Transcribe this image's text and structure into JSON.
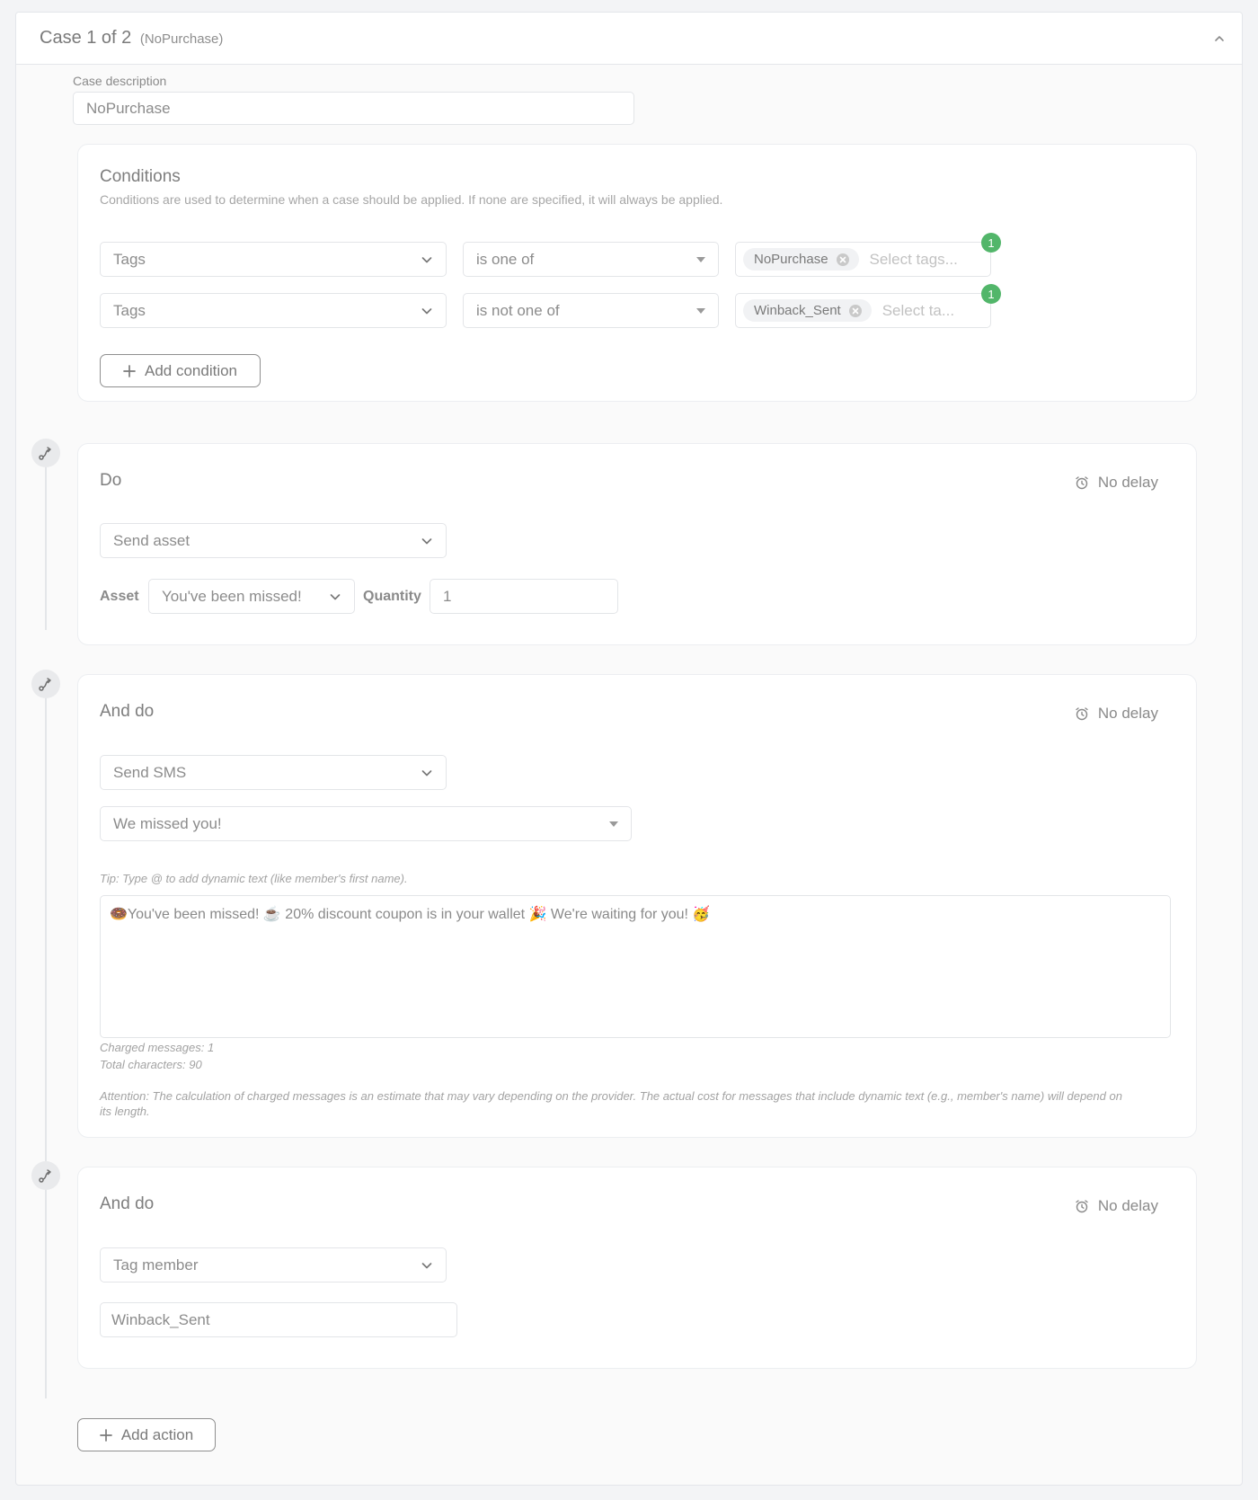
{
  "header": {
    "title": "Case 1 of 2",
    "subtitle": "(NoPurchase)"
  },
  "case_description": {
    "label": "Case description",
    "value": "NoPurchase"
  },
  "conditions": {
    "title": "Conditions",
    "description": "Conditions are used to determine when a case should be applied. If none are specified, it will always be applied.",
    "rows": [
      {
        "field": "Tags",
        "operator": "is one of",
        "tag": "NoPurchase",
        "placeholder": "Select tags...",
        "count": "1"
      },
      {
        "field": "Tags",
        "operator": "is not one of",
        "tag": "Winback_Sent",
        "placeholder": "Select ta...",
        "count": "1"
      }
    ],
    "add_label": "Add condition"
  },
  "actions": [
    {
      "title": "Do",
      "delay": "No delay",
      "action_type": "Send asset",
      "asset_label": "Asset",
      "asset_value": "You've been missed!",
      "quantity_label": "Quantity",
      "quantity_value": "1"
    },
    {
      "title": "And do",
      "delay": "No delay",
      "action_type": "Send SMS",
      "template": "We missed you!",
      "tip": "Tip: Type @ to add dynamic text (like member's first name).",
      "message": "🍩You've been missed! ☕ 20% discount coupon is in your wallet 🎉 We're waiting for you! 🥳",
      "charged": "Charged messages: 1",
      "total_chars": "Total characters: 90",
      "attention": "Attention: The calculation of charged messages is an estimate that may vary depending on the provider. The actual cost for messages that include dynamic text (e.g., member's name) will depend on its length."
    },
    {
      "title": "And do",
      "delay": "No delay",
      "action_type": "Tag member",
      "tag_value": "Winback_Sent"
    }
  ],
  "add_action_label": "Add action",
  "icons": {
    "collapse": "chevron-up-icon",
    "dropdown": "chevron-down-icon",
    "delay": "alarm-clock-icon",
    "timeline": "route-icon",
    "add": "plus-icon",
    "remove": "x-circle-icon"
  },
  "colors": {
    "badge": "#52b66a"
  }
}
